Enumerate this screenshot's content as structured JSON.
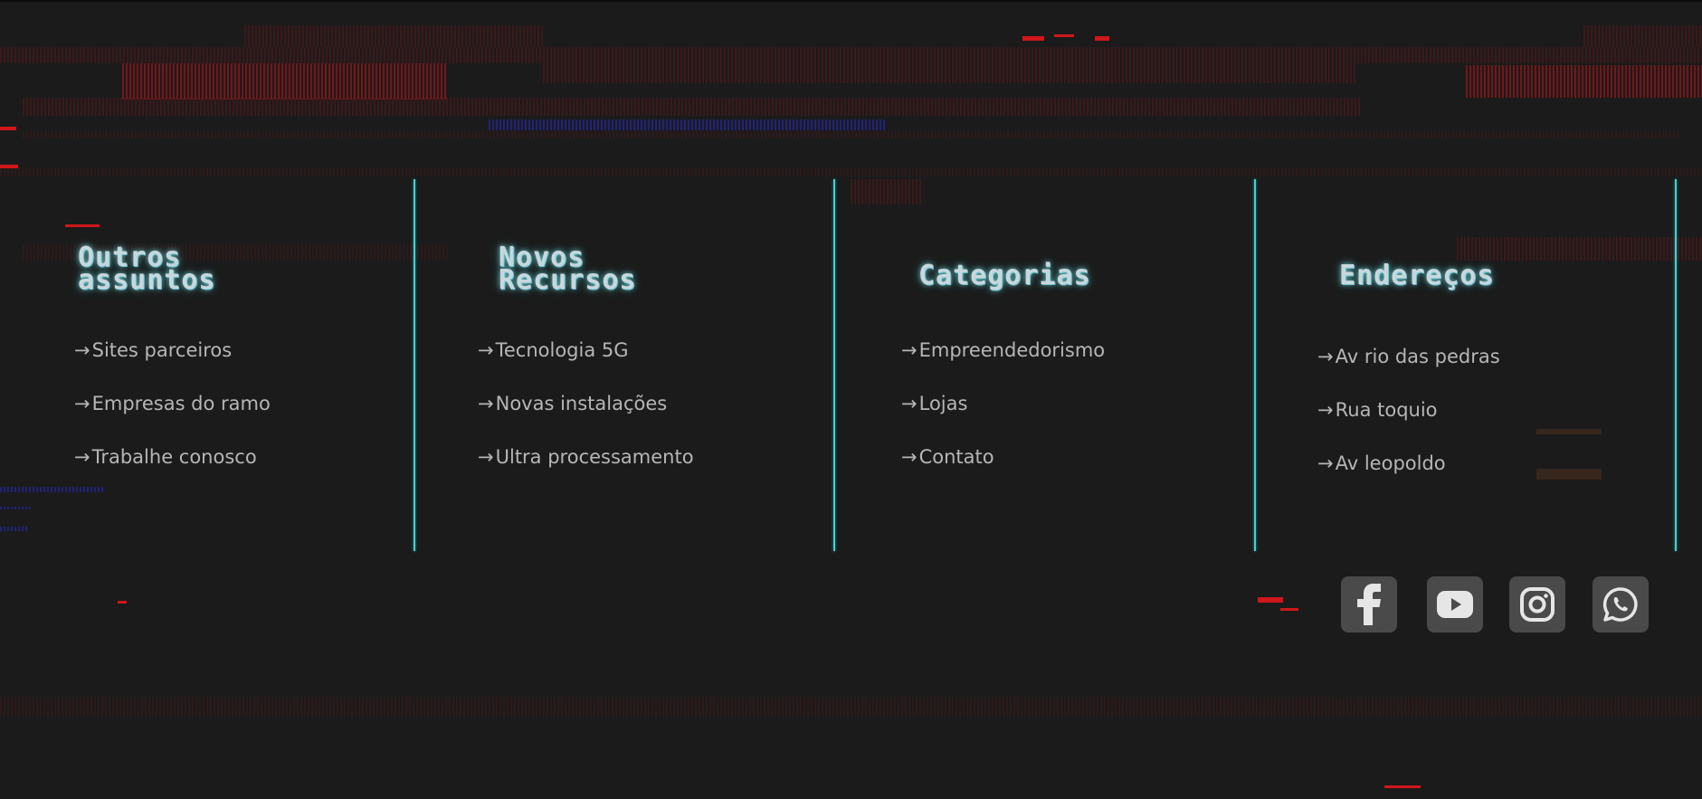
{
  "footer": {
    "columns": [
      {
        "heading": "Outros\nassuntos",
        "links": [
          "Sites parceiros",
          "Empresas do ramo",
          "Trabalhe conosco"
        ]
      },
      {
        "heading": "Novos\nRecursos",
        "links": [
          "Tecnologia 5G",
          "Novas instalações",
          "Ultra processamento"
        ]
      },
      {
        "heading": "Categorias",
        "links": [
          "Empreendedorismo",
          "Lojas",
          "Contato"
        ]
      },
      {
        "heading": "Endereços",
        "links": [
          "Av rio das pedras",
          "Rua toquio",
          "Av leopoldo"
        ]
      }
    ],
    "arrow": "→",
    "social": [
      {
        "icon": "facebook-icon"
      },
      {
        "icon": "youtube-icon"
      },
      {
        "icon": "instagram-icon"
      },
      {
        "icon": "whatsapp-icon"
      }
    ]
  },
  "colors": {
    "background": "#1b1b1b",
    "divider": "#3fd2d3",
    "heading": "#c9d7dc",
    "link": "#b6b6b6",
    "social_bg": "#4a4a4a",
    "glitch_red": "#d0161a"
  }
}
